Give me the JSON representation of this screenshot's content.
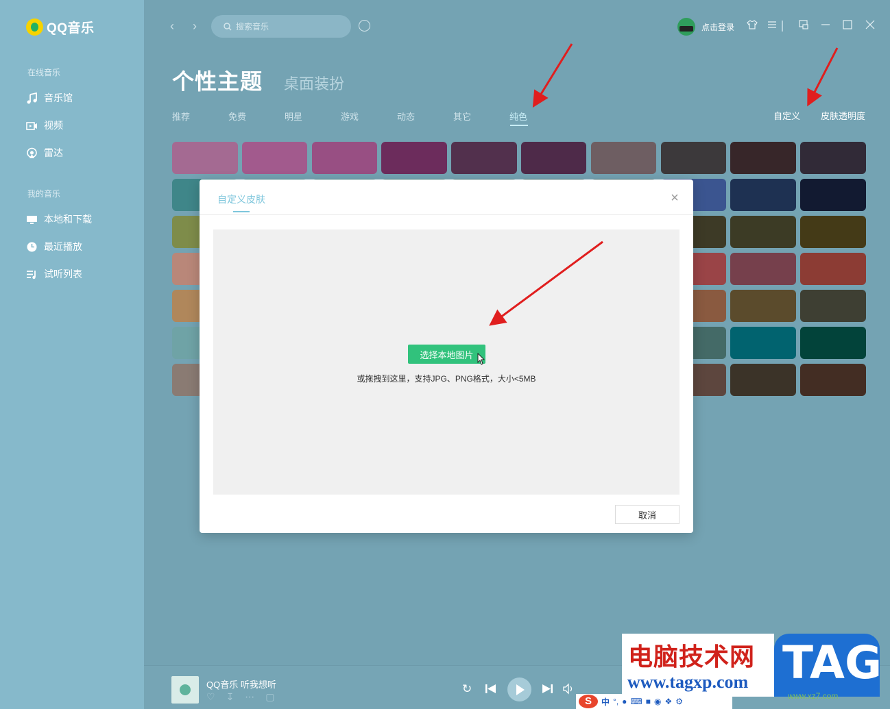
{
  "app": {
    "name": "QQ音乐"
  },
  "sidebar": {
    "sections": [
      {
        "label": "在线音乐",
        "items": [
          {
            "label": "音乐馆",
            "icon": "music-note-icon"
          },
          {
            "label": "视频",
            "icon": "video-icon"
          },
          {
            "label": "雷达",
            "icon": "radar-icon"
          }
        ]
      },
      {
        "label": "我的音乐",
        "items": [
          {
            "label": "本地和下载",
            "icon": "monitor-icon"
          },
          {
            "label": "最近播放",
            "icon": "clock-icon"
          },
          {
            "label": "试听列表",
            "icon": "playlist-icon"
          }
        ]
      }
    ]
  },
  "topbar": {
    "search_placeholder": "搜索音乐",
    "login_label": "点击登录"
  },
  "header": {
    "title": "个性主题",
    "subtitle": "桌面装扮",
    "tabs": [
      "推荐",
      "免费",
      "明星",
      "游戏",
      "动态",
      "其它",
      "纯色"
    ],
    "active_tab": "纯色",
    "custom_label": "自定义",
    "transparency_label": "皮肤透明度"
  },
  "swatches": [
    [
      "#a46a92",
      "#a25a8d",
      "#984f83",
      "#6c2c5c",
      "#52304d",
      "#4e2a49",
      "#6e5e62",
      "#3c393b",
      "#372629",
      "#312a37"
    ],
    [
      "#3f8689",
      "#3f7f82",
      "#3d7a7d",
      "#3b7476",
      "#376d70",
      "#336669",
      "#306064",
      "#3b5590",
      "#1e3152",
      "#121a31"
    ],
    [
      "#7e8c4a",
      "#798744",
      "#74823f",
      "#6f7d3b",
      "#6a7837",
      "#657333",
      "#5f6d2f",
      "#3d3a26",
      "#3c3b25",
      "#443a17"
    ],
    [
      "#b98779",
      "#b57f73",
      "#b1786d",
      "#ad7067",
      "#a86961",
      "#a4625b",
      "#a05b55",
      "#9a4447",
      "#76404c",
      "#8c3c34"
    ],
    [
      "#b0875b",
      "#ac8257",
      "#a87d52",
      "#a4784e",
      "#a0734a",
      "#9c6e46",
      "#986942",
      "#8a5a40",
      "#5b4b2c",
      "#3e3f33"
    ],
    [
      "#6fa3a6",
      "#6a9ea1",
      "#65999c",
      "#609497",
      "#5b8f92",
      "#568a8d",
      "#518588",
      "#446a67",
      "#01636f",
      "#02433a"
    ],
    [
      "#8a7b73",
      "#85766e",
      "#807169",
      "#7b6c64",
      "#76675f",
      "#71625a",
      "#6c5d55",
      "#5d463e",
      "#3b3328",
      "#432d23"
    ]
  ],
  "modal": {
    "title": "自定义皮肤",
    "select_button": "选择本地图片",
    "hint": "或拖拽到这里，支持JPG、PNG格式，大小<5MB",
    "cancel_button": "取消"
  },
  "player": {
    "song": "QQ音乐 听我想听"
  },
  "watermark": {
    "cn": "电脑技术网",
    "url": "www.tagxp.com",
    "tag": "TAG",
    "small": "www.xz7.com"
  },
  "ime": {
    "logo": "S",
    "mode": "中"
  }
}
